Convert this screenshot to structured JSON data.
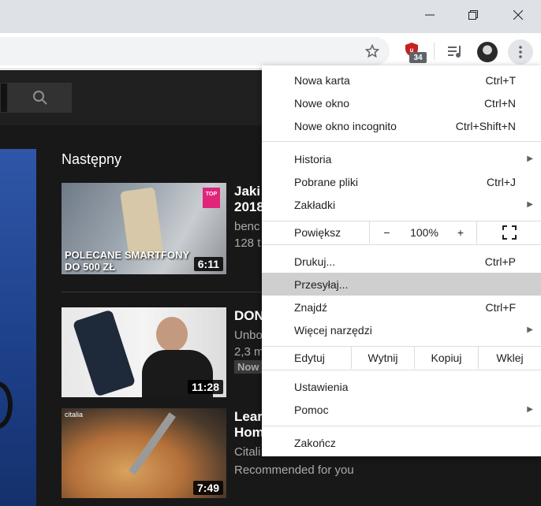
{
  "window": {
    "minimize_icon": "minimize-icon",
    "restore_icon": "restore-icon",
    "close_icon": "close-icon"
  },
  "toolbar": {
    "extension_badge": "34",
    "colors": {
      "extension_red": "#c5221f",
      "badge_bg": "#5f6368"
    }
  },
  "youtube": {
    "next_title": "Następny",
    "cards": [
      {
        "title": "Jaki",
        "title2": "2018",
        "meta1": "benc",
        "meta2": "128 t",
        "thumb_caption1": "POLECANE SMARTFONY",
        "thumb_caption2": "DO 500 ZŁ",
        "thumb_badge": "TOP",
        "duration": "6:11"
      },
      {
        "title": "DON",
        "meta1": "Unbo",
        "meta2": "2,3 m",
        "badge": "Now",
        "duration": "11:28"
      },
      {
        "title": "Lear",
        "title2": "Hom",
        "meta1": "Citali",
        "meta2": "Recommended for you",
        "thumb_brand": "citalia",
        "duration": "7:49"
      }
    ]
  },
  "menu": {
    "new_tab": {
      "label": "Nowa karta",
      "shortcut": "Ctrl+T"
    },
    "new_window": {
      "label": "Nowe okno",
      "shortcut": "Ctrl+N"
    },
    "incognito": {
      "label": "Nowe okno incognito",
      "shortcut": "Ctrl+Shift+N"
    },
    "history": {
      "label": "Historia"
    },
    "downloads": {
      "label": "Pobrane pliki",
      "shortcut": "Ctrl+J"
    },
    "bookmarks": {
      "label": "Zakładki"
    },
    "zoom": {
      "label": "Powiększ",
      "minus": "−",
      "value": "100%",
      "plus": "+"
    },
    "print": {
      "label": "Drukuj...",
      "shortcut": "Ctrl+P"
    },
    "cast": {
      "label": "Przesyłaj..."
    },
    "find": {
      "label": "Znajdź",
      "shortcut": "Ctrl+F"
    },
    "more_tools": {
      "label": "Więcej narzędzi"
    },
    "edit": {
      "label": "Edytuj",
      "cut": "Wytnij",
      "copy": "Kopiuj",
      "paste": "Wklej"
    },
    "settings": {
      "label": "Ustawienia"
    },
    "help": {
      "label": "Pomoc"
    },
    "exit": {
      "label": "Zakończ"
    }
  }
}
